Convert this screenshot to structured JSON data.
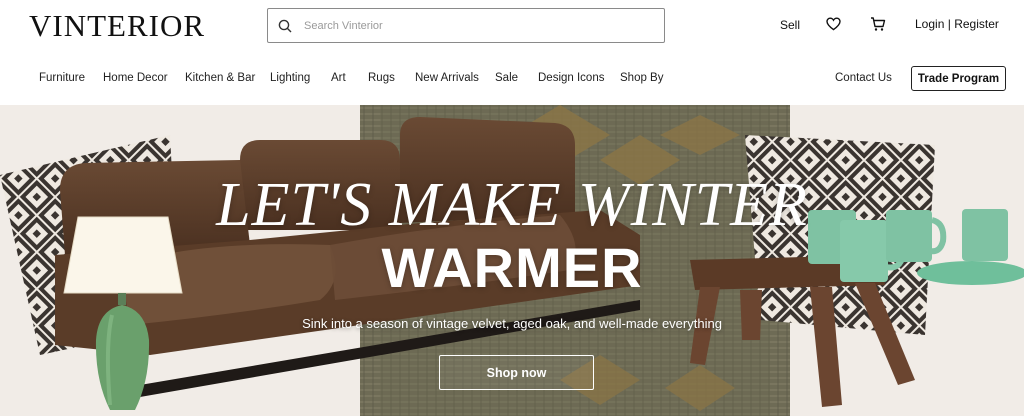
{
  "header": {
    "logo": "VINTERIOR",
    "search_placeholder": "Search Vinterior",
    "sell": "Sell",
    "login": "Login",
    "separator": "|",
    "register": "Register"
  },
  "nav": {
    "items": [
      "Furniture",
      "Home Decor",
      "Kitchen & Bar",
      "Lighting",
      "Art",
      "Rugs",
      "New Arrivals",
      "Sale",
      "Design Icons",
      "Shop By"
    ],
    "contact": "Contact Us",
    "trade": "Trade Program"
  },
  "hero": {
    "title_line1": "LET'S MAKE WINTER",
    "title_line2": "WARMER",
    "subtitle": "Sink into a season of vintage velvet, aged oak, and well-made everything",
    "cta": "Shop now"
  },
  "icons": {
    "search": "search-icon",
    "wishlist": "heart-icon",
    "cart": "cart-icon"
  }
}
